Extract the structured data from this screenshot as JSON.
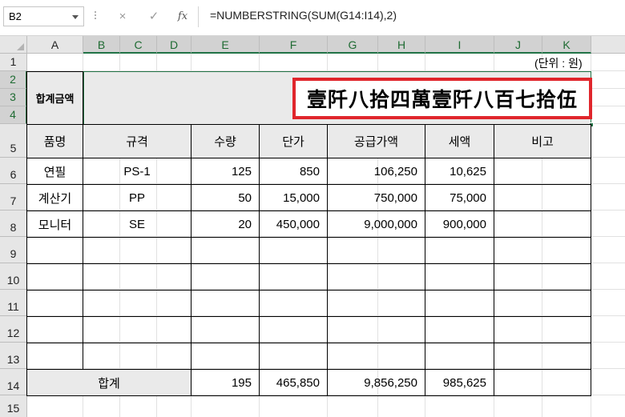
{
  "formula_bar": {
    "name_box": "B2",
    "cancel_icon": "×",
    "enter_icon": "✓",
    "fx_label": "fx",
    "formula": "=NUMBERSTRING(SUM(G14:I14),2)"
  },
  "columns": [
    "A",
    "B",
    "C",
    "D",
    "E",
    "F",
    "G",
    "H",
    "I",
    "J",
    "K"
  ],
  "rows": [
    "1",
    "2",
    "3",
    "4",
    "5",
    "6",
    "7",
    "8",
    "9",
    "10",
    "11",
    "12",
    "13",
    "14",
    "15"
  ],
  "sheet": {
    "unit_note": "(단위 : 원)",
    "total_amount_label": "합계금액",
    "total_amount_value": "壹阡八拾四萬壹阡八百七拾伍",
    "headers": [
      "품명",
      "규격",
      "수량",
      "단가",
      "공급가액",
      "세액",
      "비고"
    ],
    "items": [
      {
        "name": "연필",
        "spec": "PS-1",
        "qty": "125",
        "price": "850",
        "supply": "106,250",
        "tax": "10,625",
        "note": ""
      },
      {
        "name": "계산기",
        "spec": "PP",
        "qty": "50",
        "price": "15,000",
        "supply": "750,000",
        "tax": "75,000",
        "note": ""
      },
      {
        "name": "모니터",
        "spec": "SE",
        "qty": "20",
        "price": "450,000",
        "supply": "9,000,000",
        "tax": "900,000",
        "note": ""
      }
    ],
    "total": {
      "label": "합계",
      "qty": "195",
      "price": "465,850",
      "supply": "9,856,250",
      "tax": "985,625"
    }
  },
  "colors": {
    "accent": "#217346",
    "highlight_border": "#e0262c",
    "header_shade": "#eaeaea"
  },
  "icons": {
    "cancel": "cancel-icon",
    "enter": "enter-icon",
    "function": "fx-icon",
    "name_box_dropdown": "chevron-down-icon"
  }
}
